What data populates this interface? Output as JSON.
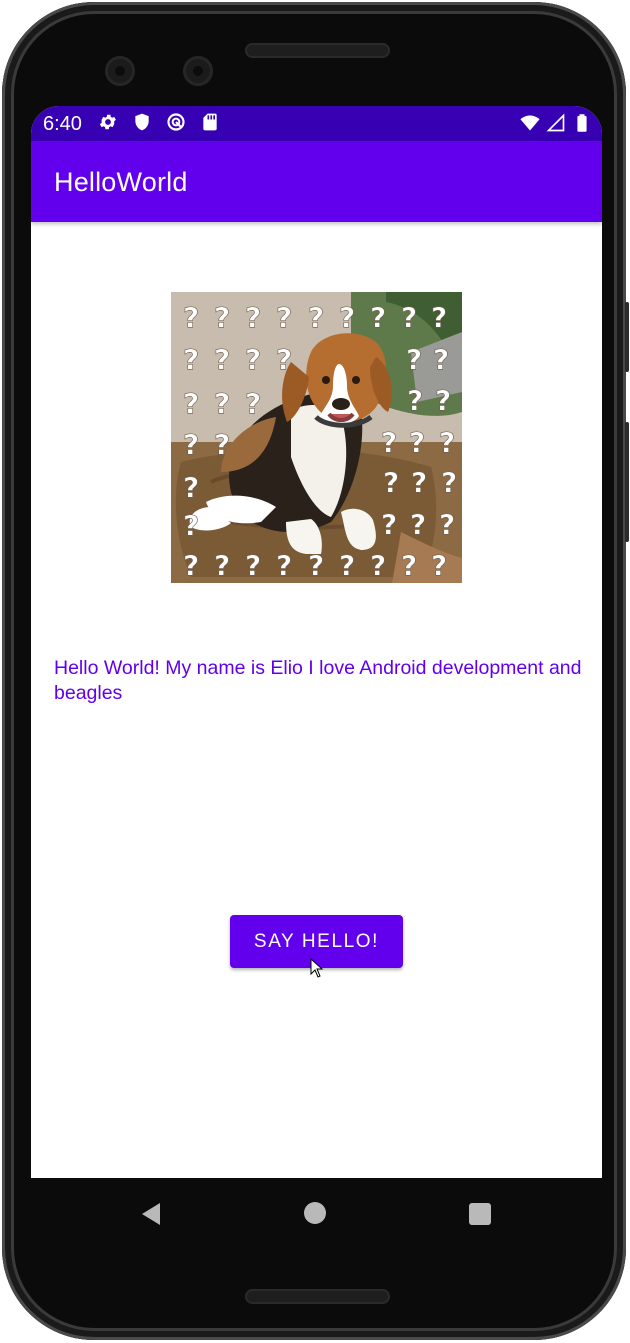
{
  "status_bar": {
    "time": "6:40",
    "left_icons": [
      "gear-icon",
      "shield-icon",
      "vpn-icon",
      "sd-card-icon"
    ],
    "right_icons": [
      "wifi-icon",
      "cell-signal-icon",
      "battery-icon"
    ]
  },
  "app_bar": {
    "title": "HelloWorld"
  },
  "main": {
    "image_icon": "beagle-photo",
    "message": "Hello World! My name is Elio I love Android development and beagles",
    "say_hello_label": "SAY HELLO!"
  },
  "nav_bar": {
    "icons": [
      "back-icon",
      "home-icon",
      "recents-icon"
    ]
  },
  "colors": {
    "status_bar": "#3700b3",
    "primary": "#6200ee",
    "on_primary": "#ffffff",
    "screen_background": "#ffffff",
    "device_frame": "#0b0b0b"
  }
}
